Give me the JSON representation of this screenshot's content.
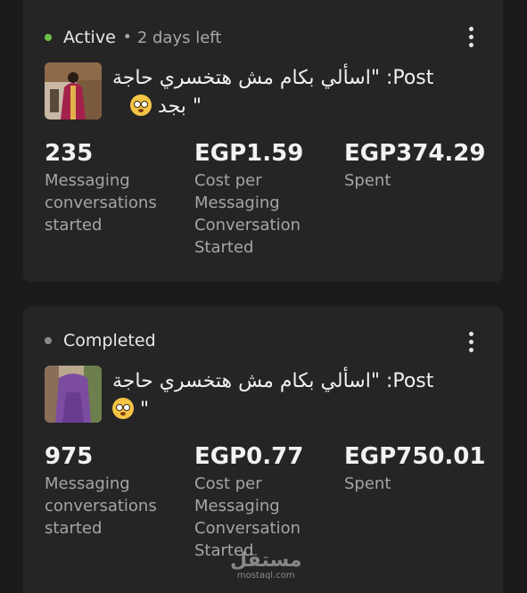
{
  "campaigns": [
    {
      "status": "Active",
      "status_color": "#6cc04a",
      "separator": "•",
      "days_left": "2 days left",
      "post_line1": "اسألي بكام مش هتخسري حاجة\" :Post",
      "post_line2": "\" بجد",
      "stats": [
        {
          "value": "235",
          "label": "Messaging conversations started"
        },
        {
          "value": "EGP1.59",
          "label": "Cost per Messaging Conversation Started"
        },
        {
          "value": "EGP374.29",
          "label": "Spent"
        }
      ]
    },
    {
      "status": "Completed",
      "status_color": "#8a8a8c",
      "post_line1": "اسألي بكام مش هتخسري حاجة\" :Post",
      "post_line2": "\"",
      "stats": [
        {
          "value": "975",
          "label": "Messaging conversations started"
        },
        {
          "value": "EGP0.77",
          "label": "Cost per Messaging Conversation Started"
        },
        {
          "value": "EGP750.01",
          "label": "Spent"
        }
      ]
    }
  ],
  "watermark": {
    "arabic": "مستقل",
    "site": "mostaql.com"
  },
  "icons": {
    "menu": "more-vertical-icon",
    "emoji": "flushed-face-icon"
  }
}
